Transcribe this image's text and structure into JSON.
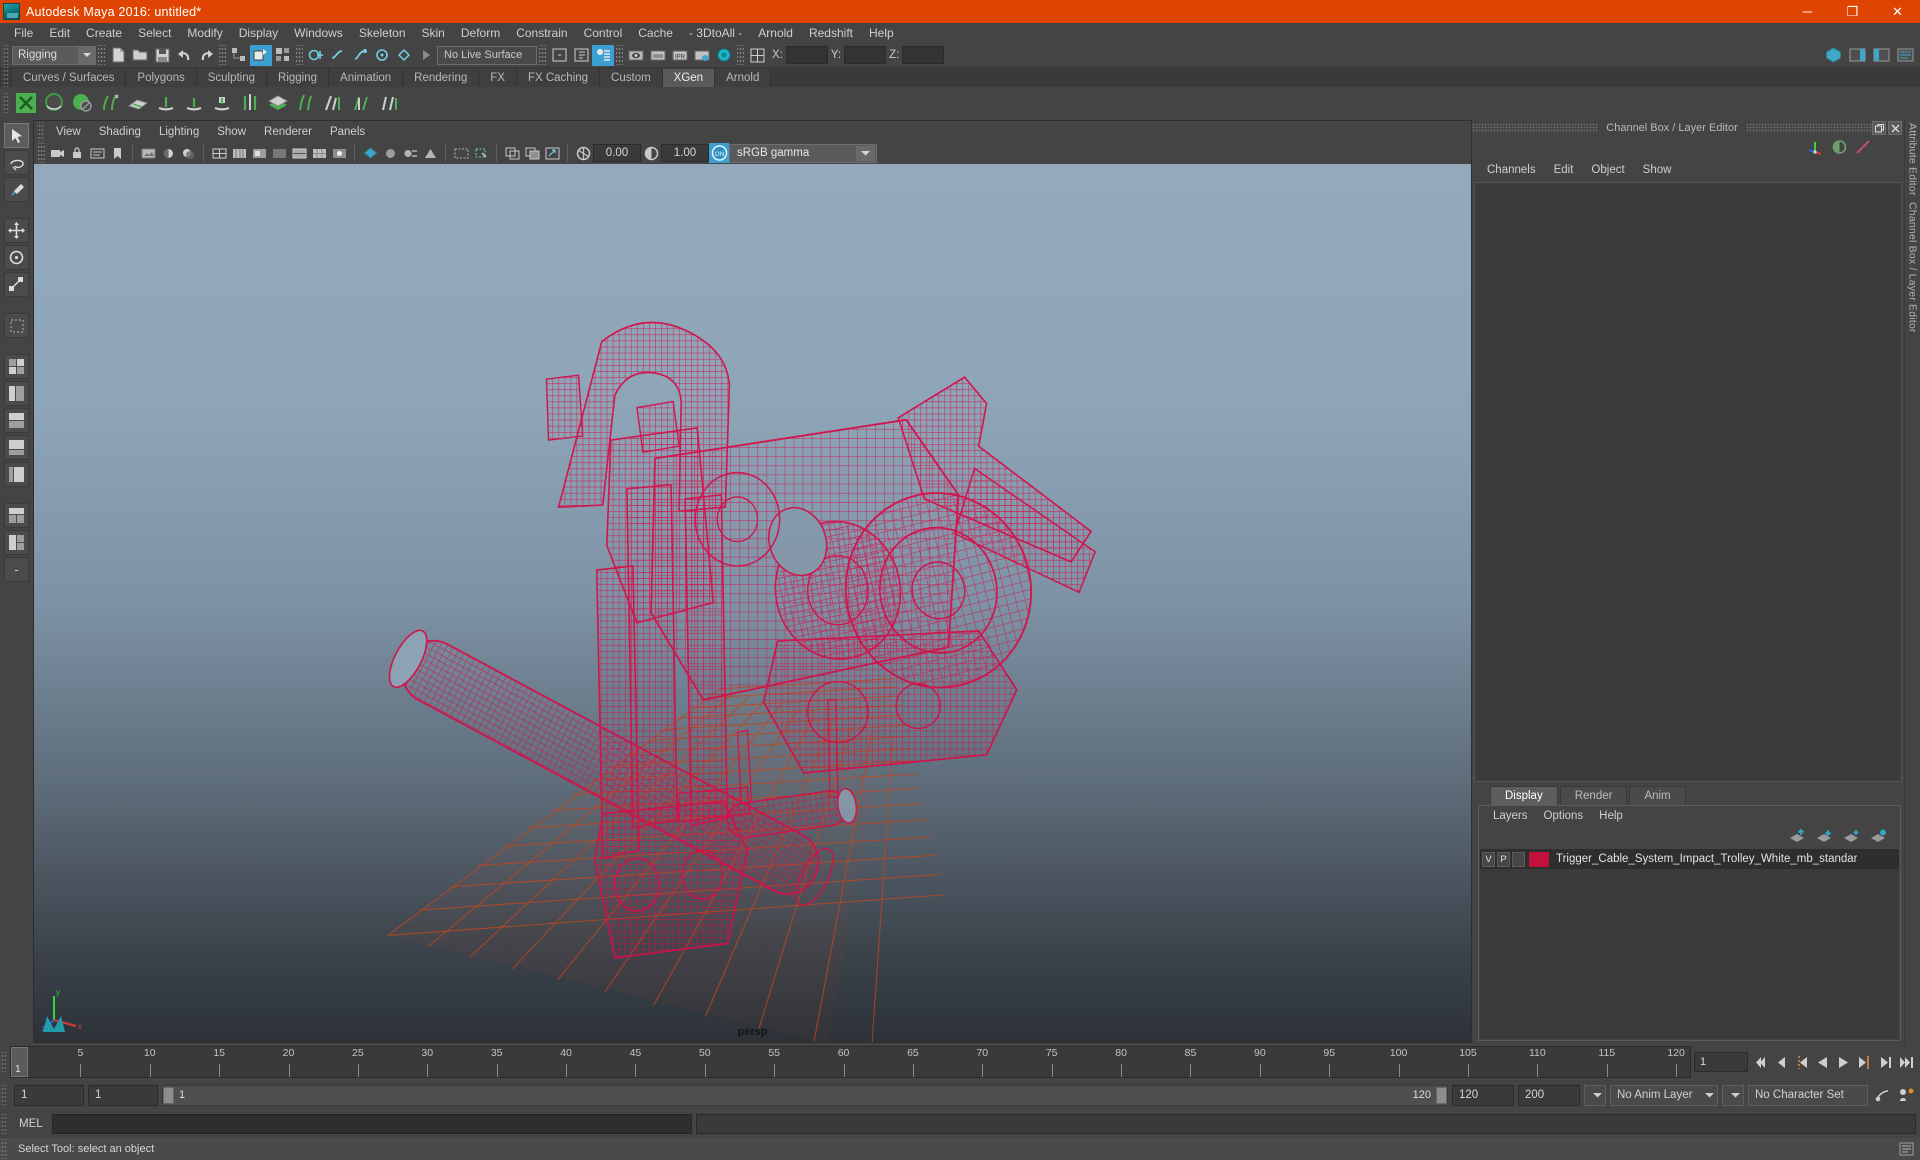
{
  "window": {
    "title": "Autodesk Maya 2016: untitled*",
    "app_icon": "maya-logo-icon",
    "minimize_label": "─",
    "maximize_label": "❐",
    "close_label": "✕",
    "titlebar_color": "#e04403"
  },
  "menubar": {
    "items": [
      {
        "label": "File"
      },
      {
        "label": "Edit"
      },
      {
        "label": "Create"
      },
      {
        "label": "Select"
      },
      {
        "label": "Modify"
      },
      {
        "label": "Display"
      },
      {
        "label": "Windows"
      },
      {
        "label": "Skeleton"
      },
      {
        "label": "Skin"
      },
      {
        "label": "Deform"
      },
      {
        "label": "Constrain"
      },
      {
        "label": "Control"
      },
      {
        "label": "Cache"
      },
      {
        "label": "- 3DtoAll -"
      },
      {
        "label": "Arnold"
      },
      {
        "label": "Redshift"
      },
      {
        "label": "Help"
      }
    ]
  },
  "statusline": {
    "menuset": "Rigging",
    "live_surface": "No Live Surface",
    "coord_x_label": "X:",
    "coord_y_label": "Y:",
    "coord_z_label": "Z:",
    "coord_x_value": "",
    "coord_y_value": "",
    "coord_z_value": ""
  },
  "shelf": {
    "tabs": [
      {
        "label": "Curves / Surfaces",
        "active": false
      },
      {
        "label": "Polygons",
        "active": false
      },
      {
        "label": "Sculpting",
        "active": false
      },
      {
        "label": "Rigging",
        "active": false
      },
      {
        "label": "Animation",
        "active": false
      },
      {
        "label": "Rendering",
        "active": false
      },
      {
        "label": "FX",
        "active": false
      },
      {
        "label": "FX Caching",
        "active": false
      },
      {
        "label": "Custom",
        "active": false
      },
      {
        "label": "XGen",
        "active": true
      },
      {
        "label": "Arnold",
        "active": false
      }
    ],
    "active_tab": "XGen"
  },
  "viewport": {
    "menu": [
      {
        "label": "View"
      },
      {
        "label": "Shading"
      },
      {
        "label": "Lighting"
      },
      {
        "label": "Show"
      },
      {
        "label": "Renderer"
      },
      {
        "label": "Panels"
      }
    ],
    "exposure_value": "0.00",
    "gamma_value": "1.00",
    "color_management_toggle": "ON",
    "color_profile": "sRGB gamma",
    "camera_label": "persp",
    "wireframe_color": "#d4104a",
    "grid_color": "#c0461f",
    "axis_x_label": "x",
    "axis_y_label": "y",
    "axis_z_label": "z"
  },
  "right_panel": {
    "title": "Channel Box / Layer Editor",
    "menu": [
      {
        "label": "Channels"
      },
      {
        "label": "Edit"
      },
      {
        "label": "Object"
      },
      {
        "label": "Show"
      }
    ],
    "attribute_editor_label": "Attribute Editor",
    "channel_box_label": "Channel Box / Layer Editor"
  },
  "layer_editor": {
    "tabs": [
      {
        "label": "Display",
        "active": true
      },
      {
        "label": "Render",
        "active": false
      },
      {
        "label": "Anim",
        "active": false
      }
    ],
    "menu": [
      {
        "label": "Layers"
      },
      {
        "label": "Options"
      },
      {
        "label": "Help"
      }
    ],
    "layers": [
      {
        "visibility": "V",
        "playback": "P",
        "state": "",
        "color": "#c2113d",
        "name": "Trigger_Cable_System_Impact_Trolley_White_mb_standar"
      }
    ]
  },
  "timeline": {
    "current_frame": "1",
    "start_marker": "1",
    "ticks": [
      5,
      10,
      15,
      20,
      25,
      30,
      35,
      40,
      45,
      50,
      55,
      60,
      65,
      70,
      75,
      80,
      85,
      90,
      95,
      100,
      105,
      110,
      115,
      120
    ],
    "frame_field": "1",
    "playback_buttons": [
      "go-to-start-icon",
      "step-back-key-icon",
      "step-back-frame-icon",
      "play-backwards-icon",
      "play-forwards-icon",
      "step-forward-frame-icon",
      "step-forward-key-icon",
      "go-to-end-icon"
    ]
  },
  "range": {
    "anim_start": "1",
    "range_start": "1",
    "slider_start_label": "1",
    "slider_end_label": "120",
    "range_end": "120",
    "anim_end": "200",
    "anim_layer": "No Anim Layer",
    "character_set": "No Character Set"
  },
  "command_line": {
    "language_label": "MEL",
    "input_value": "",
    "output_value": ""
  },
  "helpline": {
    "message": "Select Tool: select an object"
  }
}
